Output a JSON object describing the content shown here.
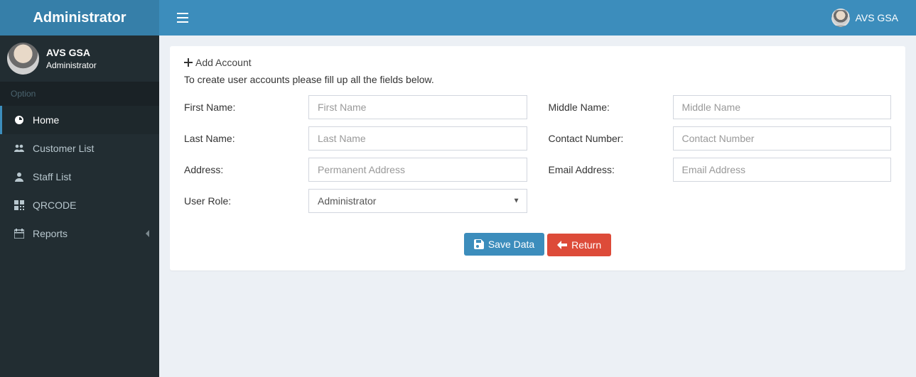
{
  "header": {
    "brand": "Administrator",
    "user_name": "AVS GSA"
  },
  "sidebar": {
    "user": {
      "name": "AVS GSA",
      "role": "Administrator"
    },
    "section_label": "Option",
    "items": [
      {
        "label": "Home"
      },
      {
        "label": "Customer List"
      },
      {
        "label": "Staff List"
      },
      {
        "label": "QRCODE"
      },
      {
        "label": "Reports"
      }
    ]
  },
  "panel": {
    "title": "Add Account",
    "description": "To create user accounts please fill up all the fields below."
  },
  "form": {
    "left": {
      "first_name": {
        "label": "First Name:",
        "placeholder": "First Name",
        "value": ""
      },
      "last_name": {
        "label": "Last Name:",
        "placeholder": "Last Name",
        "value": ""
      },
      "address": {
        "label": "Address:",
        "placeholder": "Permanent Address",
        "value": ""
      },
      "user_role": {
        "label": "User Role:",
        "value": "Administrator"
      }
    },
    "right": {
      "middle_name": {
        "label": "Middle Name:",
        "placeholder": "Middle Name",
        "value": ""
      },
      "contact_number": {
        "label": "Contact Number:",
        "placeholder": "Contact Number",
        "value": ""
      },
      "email": {
        "label": "Email Address:",
        "placeholder": "Email Address",
        "value": ""
      }
    }
  },
  "actions": {
    "save": "Save Data",
    "return": "Return"
  }
}
